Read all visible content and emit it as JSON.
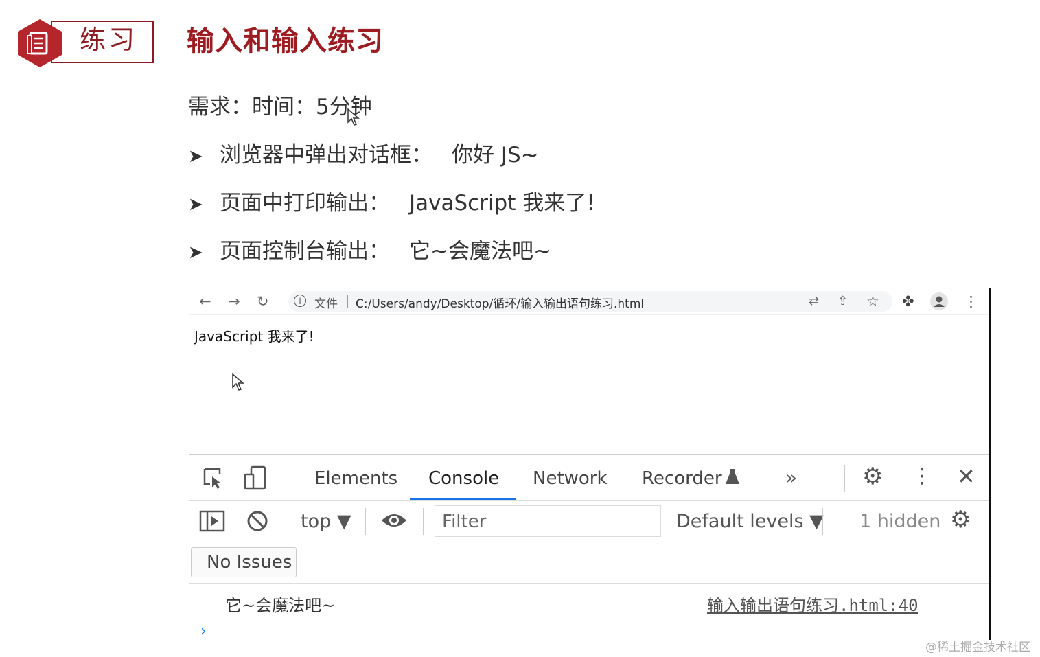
{
  "slide": {
    "badge_label": "练习",
    "title": "输入和输入练习",
    "requirement": "需求：时间：5分钟",
    "bullets": [
      {
        "label": "浏览器中弹出对话框：",
        "value": "你好 JS~"
      },
      {
        "label": "页面中打印输出：",
        "value": "JavaScript 我来了!"
      },
      {
        "label": "页面控制台输出：",
        "value": "它~会魔法吧~"
      }
    ]
  },
  "browser": {
    "omnibox_file_label": "文件",
    "url": "C:/Users/andy/Desktop/循环/输入输出语句练习.html",
    "page_text": "JavaScript 我来了!"
  },
  "devtools": {
    "tabs": [
      "Elements",
      "Console",
      "Network",
      "Recorder"
    ],
    "active_tab": "Console",
    "context": "top ▼",
    "filter_placeholder": "Filter",
    "levels": "Default levels ▼",
    "hidden_count": "1 hidden",
    "issues": "No Issues",
    "console_message": "它~会魔法吧~",
    "console_source": "输入输出语句练习.html:40",
    "prompt": "›"
  },
  "watermark": "@稀土掘金技术社区",
  "colors": {
    "brand": "#9c1c22",
    "accent": "#1a73e8"
  }
}
